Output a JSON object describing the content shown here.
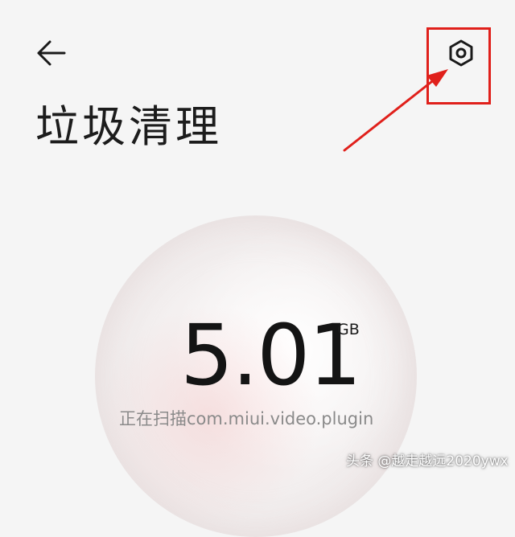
{
  "header": {
    "back_icon": "arrow-left-icon",
    "settings_icon": "hexagon-gear-icon",
    "title": "垃圾清理"
  },
  "scan": {
    "value": "5.01",
    "unit": "GB",
    "status": "正在扫描com.miui.video.plugin"
  },
  "watermark": {
    "text": "头条 @越走越远2020ywx"
  },
  "colors": {
    "annotation_red": "#e0201b",
    "background": "#f5f5f5",
    "status_gray": "#8a8a8a"
  }
}
